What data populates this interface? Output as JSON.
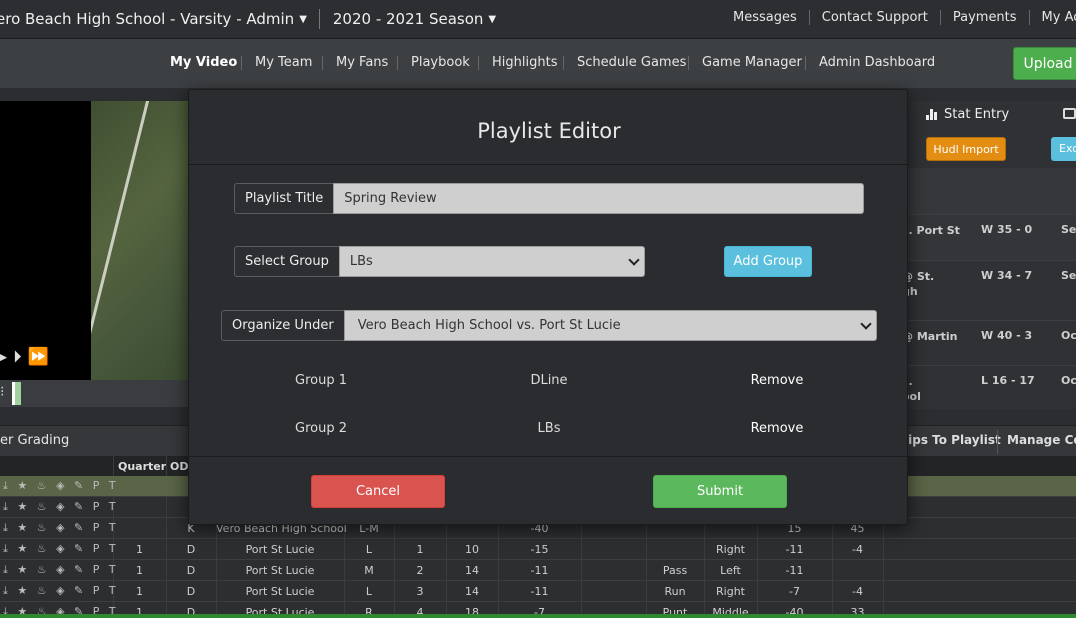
{
  "topbar": {
    "team": "ero Beach High School - Varsity - Admin",
    "season": "2020 - 2021 Season",
    "links": [
      "Messages",
      "Contact Support",
      "Payments",
      "My Accou"
    ]
  },
  "nav": {
    "items": [
      "My Video",
      "My Team",
      "My Fans",
      "Playbook",
      "Highlights",
      "Schedule Games",
      "Game Manager",
      "Admin Dashboard"
    ],
    "upload": "Upload"
  },
  "right_panel": {
    "stat_entry": "Stat Entry",
    "hudl_import": "Hudl Import",
    "exc": "Exc",
    "games": [
      {
        "opp": "s. Port St",
        "result": "W 35 - 0",
        "date": "Sep"
      },
      {
        "opp": "@ St.\ngh",
        "result": "W 34 - 7",
        "date": "Sep"
      },
      {
        "opp": "@ Martin",
        "result": "W 40 - 3",
        "date": "Oc"
      },
      {
        "opp": "s.\nool",
        "result": "L 16 - 17",
        "date": "Oc"
      }
    ]
  },
  "grading": {
    "title": "er Grading",
    "clips_to_playlist": "lips To Playlist",
    "manage_columns": "Manage Colu"
  },
  "table": {
    "headers": [
      "Quarter",
      "ODI"
    ],
    "icons": "⤓ ★ ♨ ◈ ✎ P T",
    "rows": [
      {
        "q": "",
        "odk": "",
        "team": "",
        "hash": "",
        "dn": "",
        "dist": "",
        "yl": "",
        "play": "",
        "dir": "",
        "gn": "",
        "pen": ""
      },
      {
        "q": "",
        "odk": "",
        "team": "",
        "hash": "",
        "dn": "",
        "dist": "",
        "yl": "",
        "play": "",
        "dir": "",
        "gn": "",
        "pen": ""
      },
      {
        "q": "",
        "odk": "K",
        "team": "Vero Beach High School",
        "hash": "L-M",
        "dn": "",
        "dist": "",
        "yl": "-40",
        "play": "",
        "dir": "",
        "gn": "15",
        "pen": "45"
      },
      {
        "q": "1",
        "odk": "D",
        "team": "Port St Lucie",
        "hash": "L",
        "dn": "1",
        "dist": "10",
        "yl": "-15",
        "play": "",
        "dir": "Right",
        "gn": "-11",
        "pen": "-4"
      },
      {
        "q": "1",
        "odk": "D",
        "team": "Port St Lucie",
        "hash": "M",
        "dn": "2",
        "dist": "14",
        "yl": "-11",
        "play": "Pass",
        "dir": "Left",
        "gn": "-11",
        "pen": ""
      },
      {
        "q": "1",
        "odk": "D",
        "team": "Port St Lucie",
        "hash": "L",
        "dn": "3",
        "dist": "14",
        "yl": "-11",
        "play": "Run",
        "dir": "Right",
        "gn": "-7",
        "pen": "-4"
      },
      {
        "q": "1",
        "odk": "D",
        "team": "Port St Lucie",
        "hash": "R",
        "dn": "4",
        "dist": "18",
        "yl": "-7",
        "play": "Punt",
        "dir": "Middle",
        "gn": "-40",
        "pen": "33"
      }
    ]
  },
  "modal": {
    "title": "Playlist Editor",
    "playlist_title_label": "Playlist Title",
    "playlist_title_value": "Spring Review",
    "select_group_label": "Select Group",
    "select_group_value": "LBs",
    "add_group": "Add Group",
    "organize_label": "Organize Under",
    "organize_value": "Vero Beach High School vs. Port St Lucie",
    "groups": [
      {
        "name": "Group 1",
        "value": "DLine",
        "action": "Remove"
      },
      {
        "name": "Group 2",
        "value": "LBs",
        "action": "Remove"
      }
    ],
    "cancel": "Cancel",
    "submit": "Submit"
  },
  "colors": {
    "cancel": "#d9534f",
    "submit": "#5cb85c",
    "add_group": "#5bc0de",
    "hudl": "#e38d13",
    "upload": "#4cae4c"
  }
}
